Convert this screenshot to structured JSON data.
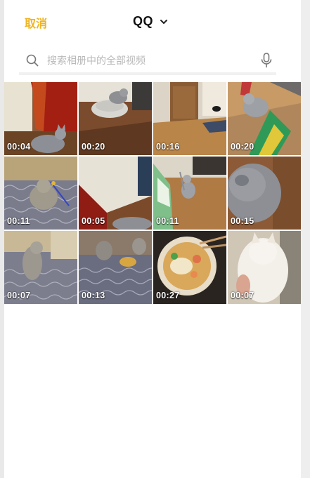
{
  "header": {
    "cancel_label": "取消",
    "album_name": "QQ"
  },
  "search": {
    "placeholder": "搜索相册中的全部视频"
  },
  "videos": [
    {
      "duration": "00:04",
      "thumb": "cat-by-red-door"
    },
    {
      "duration": "00:20",
      "thumb": "cat-on-round-bed"
    },
    {
      "duration": "00:16",
      "thumb": "kitten-on-wood-floor"
    },
    {
      "duration": "00:20",
      "thumb": "cat-on-colorful-mat"
    },
    {
      "duration": "00:11",
      "thumb": "cat-playing-on-blanket"
    },
    {
      "duration": "00:05",
      "thumb": "cat-by-door-corner"
    },
    {
      "duration": "00:11",
      "thumb": "cat-near-green-box"
    },
    {
      "duration": "00:15",
      "thumb": "grey-fluffy-cat"
    },
    {
      "duration": "00:07",
      "thumb": "cat-on-bed"
    },
    {
      "duration": "00:13",
      "thumb": "cats-on-patterned-blanket"
    },
    {
      "duration": "00:27",
      "thumb": "noodle-bowl-food"
    },
    {
      "duration": "00:07",
      "thumb": "white-cat-closeup"
    }
  ],
  "colors": {
    "accent": "#f0b41e",
    "title": "#111111",
    "placeholder": "#b8b8b8"
  },
  "icons": [
    "search-icon",
    "microphone-icon",
    "chevron-down-icon"
  ]
}
